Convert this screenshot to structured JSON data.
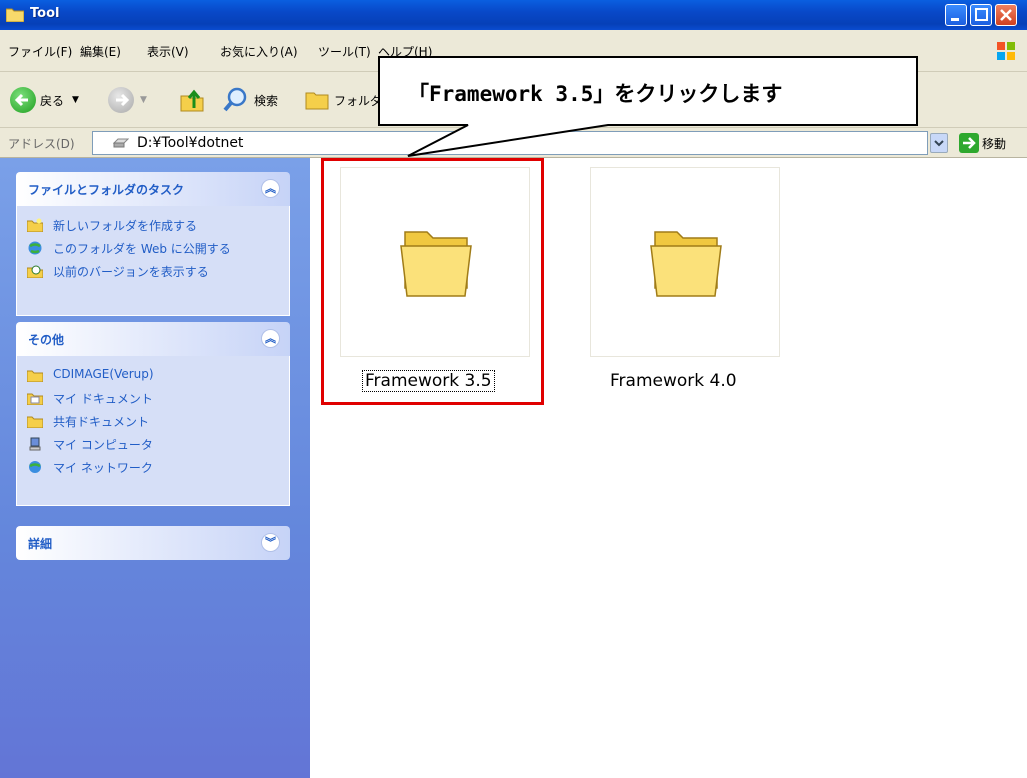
{
  "window": {
    "title": "Tool"
  },
  "menu": [
    "ファイル(F)",
    "編集(E)",
    "表示(V)",
    "お気に入り(A)",
    "ツール(T)",
    "ヘルプ(H)"
  ],
  "toolbar": {
    "back_label": "戻る",
    "search_label": "検索",
    "folders_label": "フォルダ"
  },
  "address": {
    "label": "アドレス(D)",
    "path": "D:¥Tool¥dotnet",
    "go_label": "移動"
  },
  "tasks_panel": {
    "title": "ファイルとフォルダのタスク",
    "items": [
      "新しいフォルダを作成する",
      "このフォルダを Web に公開する",
      "以前のバージョンを表示する"
    ]
  },
  "other_panel": {
    "title": "その他",
    "items": [
      "CDIMAGE(Verup)",
      "マイ ドキュメント",
      "共有ドキュメント",
      "マイ コンピュータ",
      "マイ ネットワーク"
    ]
  },
  "details_panel": {
    "title": "詳細"
  },
  "folders": [
    {
      "name": "Framework 3.5",
      "selected": true
    },
    {
      "name": "Framework 4.0",
      "selected": false
    }
  ],
  "callout": {
    "text": "「Framework 3.5」をクリックします"
  },
  "colors": {
    "highlight": "#e00000",
    "link": "#215dc6",
    "titlebar": "#0848c8"
  }
}
